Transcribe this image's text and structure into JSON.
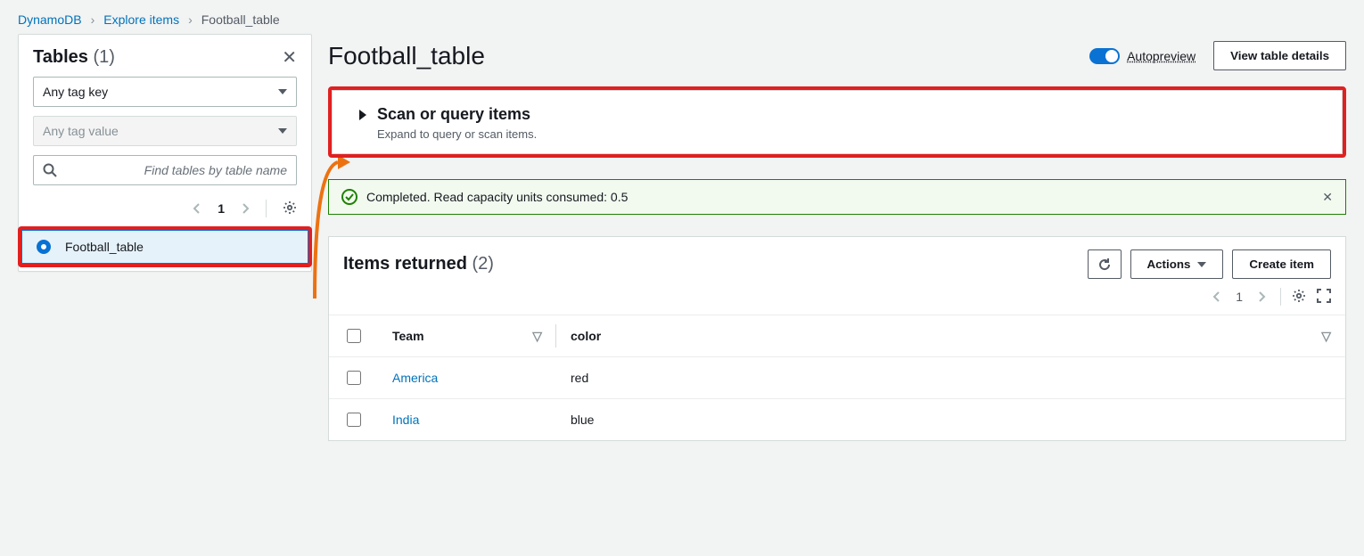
{
  "breadcrumbs": {
    "root": "DynamoDB",
    "mid": "Explore items",
    "current": "Football_table"
  },
  "sidebar": {
    "title": "Tables",
    "count": "(1)",
    "tagkey": "Any tag key",
    "tagvalue": "Any tag value",
    "search_placeholder": "Find tables by table name",
    "page": "1",
    "selected_table": "Football_table"
  },
  "main": {
    "title": "Football_table",
    "autopreview": "Autopreview",
    "view_details": "View table details"
  },
  "scan": {
    "title": "Scan or query items",
    "subtitle": "Expand to query or scan items."
  },
  "alert": {
    "text": "Completed. Read capacity units consumed: 0.5"
  },
  "items": {
    "title": "Items returned",
    "count": "(2)",
    "actions": "Actions",
    "create": "Create item",
    "page": "1",
    "columns": [
      "Team",
      "color"
    ],
    "rows": [
      {
        "team": "America",
        "color": "red"
      },
      {
        "team": "India",
        "color": "blue"
      }
    ]
  }
}
